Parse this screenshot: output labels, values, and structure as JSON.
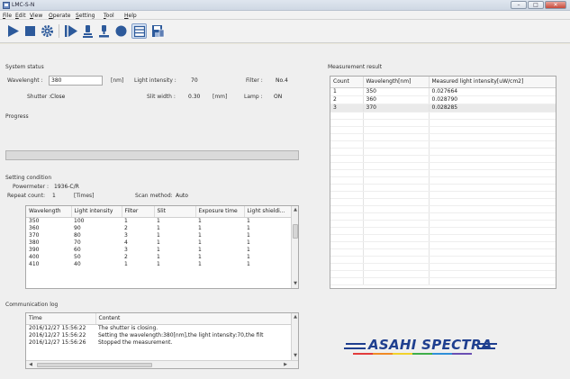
{
  "window": {
    "title": "LMC-S-N",
    "min": "–",
    "max": "□",
    "close": "✕"
  },
  "menu": [
    {
      "u": "F",
      "rest": "ile"
    },
    {
      "u": "E",
      "rest": "dit"
    },
    {
      "u": "V",
      "rest": "iew"
    },
    {
      "u": "O",
      "rest": "perate"
    },
    {
      "u": "S",
      "rest": "etting"
    },
    {
      "u": "T",
      "rest": "ool"
    },
    {
      "u": "H",
      "rest": "elp"
    }
  ],
  "toolbar": {
    "icons": [
      "play-icon",
      "stop-icon",
      "settings-gear-icon",
      "step-forward-icon",
      "lamp-on-icon",
      "lamp-off-icon",
      "record-icon",
      "layout-window-icon",
      "save-icon"
    ],
    "accent": "#2d5a9b"
  },
  "system_status": {
    "label": "System status",
    "wavelength_label": "Wavelenght :",
    "wavelength_value": "380",
    "wavelength_unit": "[nm]",
    "light_intensity_label": "Light intensity :",
    "light_intensity_value": "70",
    "filter_label": "Filter :",
    "filter_value": "No.4",
    "shutter_label": "Shutter :",
    "shutter_value": "Close",
    "slit_label": "Slit width :",
    "slit_value": "0.30",
    "slit_unit": "[mm]",
    "lamp_label": "Lamp :",
    "lamp_value": "ON"
  },
  "progress": {
    "label": "Progress",
    "fraction": 0.0
  },
  "setting_condition": {
    "label": "Setting condition",
    "powermeter_label": "Powermeter :",
    "powermeter_value": "1936-C/R",
    "repeat_label": "Repeat count:",
    "repeat_value": "1",
    "repeat_unit": "[Times]",
    "scan_label": "Scan method:",
    "scan_value": "Auto",
    "columns": [
      "Wavelength",
      "Light intensity",
      "Filter",
      "Slit",
      "Exposure time",
      "Light shieldi..."
    ],
    "rows": [
      [
        "350",
        "100",
        "1",
        "1",
        "1",
        "1"
      ],
      [
        "360",
        "90",
        "2",
        "1",
        "1",
        "1"
      ],
      [
        "370",
        "80",
        "3",
        "1",
        "1",
        "1"
      ],
      [
        "380",
        "70",
        "4",
        "1",
        "1",
        "1"
      ],
      [
        "390",
        "60",
        "3",
        "1",
        "1",
        "1"
      ],
      [
        "400",
        "50",
        "2",
        "1",
        "1",
        "1"
      ],
      [
        "410",
        "40",
        "1",
        "1",
        "1",
        "1"
      ]
    ]
  },
  "communication_log": {
    "label": "Communication log",
    "columns": [
      "Time",
      "Content"
    ],
    "rows": [
      [
        "2016/12/27 15:56:22",
        "The shutter is closing."
      ],
      [
        "2016/12/27 15:56:22",
        "Setting the wavelength:380[nm],the light intensity:70,the filt"
      ],
      [
        "2016/12/27 15:56:26",
        "Stopped the measurement."
      ]
    ]
  },
  "measurement_result": {
    "label": "Measurement result",
    "columns": [
      "Count",
      "Wavelength[nm]",
      "Measured light intensity[uW/cm2]"
    ],
    "rows": [
      [
        "1",
        "350",
        "0.027664"
      ],
      [
        "2",
        "360",
        "0.028790"
      ],
      [
        "3",
        "370",
        "0.028285"
      ]
    ]
  },
  "logo": {
    "text": "ASAHI SPECTRA",
    "color": "#1f3f8f"
  }
}
